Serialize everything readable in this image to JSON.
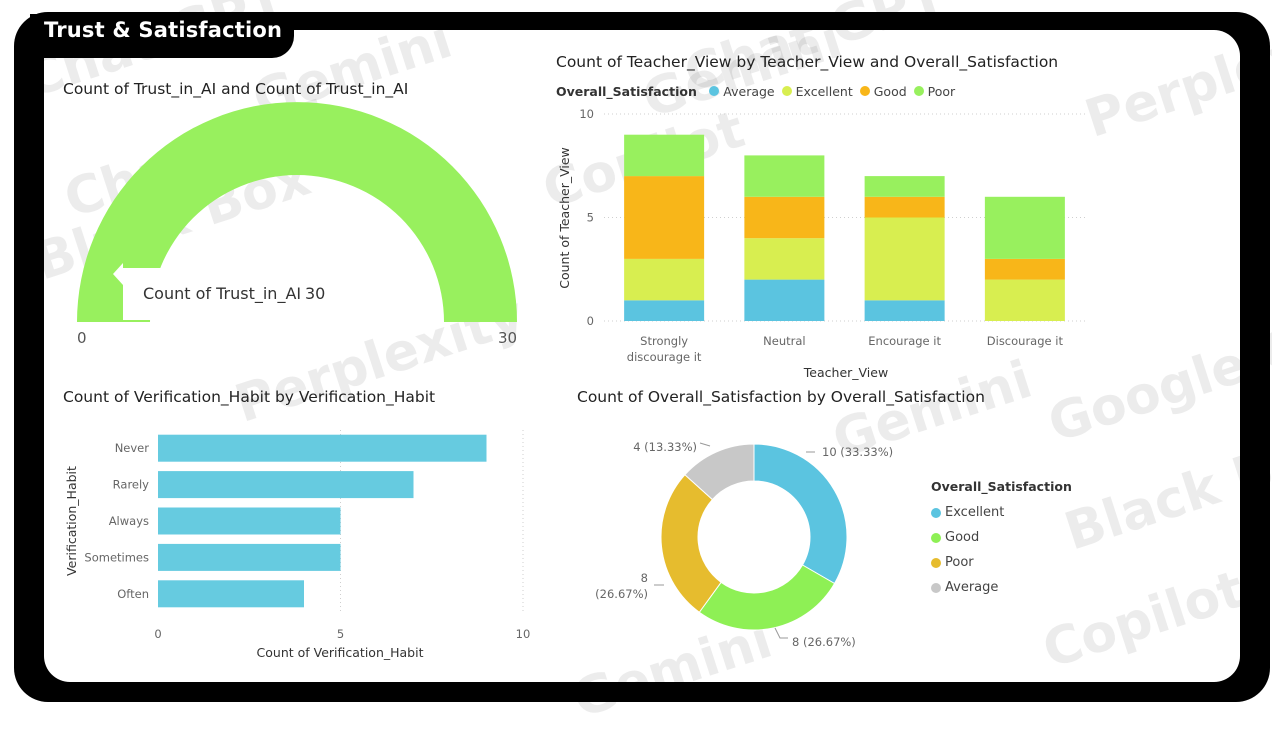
{
  "dashboard": {
    "title": "Trust & Satisfaction"
  },
  "colors": {
    "Average": "#5bc4e0",
    "Excellent": "#d8ee50",
    "Good": "#f8b619",
    "Poor": "#98f05e",
    "gauge_fill": "#98f05e",
    "bar_fill": "#66cbe0",
    "donut_Excellent": "#5bc4e0",
    "donut_Good": "#8ef055",
    "donut_Poor": "#e6bc2e",
    "donut_Average": "#c8c8c8"
  },
  "watermarks": [
    "Chat GPT",
    "Gemini",
    "Chat GPT",
    "Gemini",
    "Perplexity",
    "Chat GPT",
    "Black Box",
    "Copilot",
    "Google Gemini",
    "Black Box",
    "Copilot",
    "Gemini",
    "Perplexity",
    "Gemini"
  ],
  "chart_data": [
    {
      "type": "gauge",
      "title": "Count of Trust_in_AI and Count of Trust_in_AI",
      "value": 30,
      "min": 0,
      "max": 30,
      "min_label": "0",
      "max_label": "30",
      "tooltip_label": "Count of Trust_in_AI",
      "tooltip_value": "30"
    },
    {
      "type": "bar",
      "stacked": true,
      "title": "Count of Teacher_View by Teacher_View and Overall_Satisfaction",
      "xlabel": "Teacher_View",
      "ylabel": "Count of Teacher_View",
      "legend_title": "Overall_Satisfaction",
      "legend_position": "top-left",
      "categories": [
        [
          "Strongly",
          "discourage it"
        ],
        [
          "Neutral"
        ],
        [
          "Encourage it"
        ],
        [
          "Discourage it"
        ]
      ],
      "series": [
        {
          "name": "Average",
          "values": [
            1,
            2,
            1,
            0
          ]
        },
        {
          "name": "Excellent",
          "values": [
            2,
            2,
            4,
            2
          ]
        },
        {
          "name": "Good",
          "values": [
            4,
            2,
            1,
            1
          ]
        },
        {
          "name": "Poor",
          "values": [
            2,
            2,
            1,
            3
          ]
        }
      ],
      "ylim": [
        0,
        10
      ],
      "yticks": [
        "0",
        "5",
        "10"
      ],
      "grid": true
    },
    {
      "type": "bar",
      "orientation": "horizontal",
      "title": "Count of Verification_Habit by Verification_Habit",
      "xlabel": "Count of Verification_Habit",
      "ylabel": "Verification_Habit",
      "categories": [
        "Never",
        "Rarely",
        "Always",
        "Sometimes",
        "Often"
      ],
      "values": [
        9,
        7,
        5,
        5,
        4
      ],
      "xlim": [
        0,
        10
      ],
      "xticks": [
        "0",
        "5",
        "10"
      ],
      "grid": true
    },
    {
      "type": "pie",
      "donut": true,
      "title": "Count of Overall_Satisfaction by Overall_Satisfaction",
      "legend_title": "Overall_Satisfaction",
      "legend_position": "right",
      "slices": [
        {
          "name": "Excellent",
          "value": 10,
          "label": "10 (33.33%)"
        },
        {
          "name": "Good",
          "value": 8,
          "label": "8 (26.67%)"
        },
        {
          "name": "Poor",
          "value": 8,
          "label_lines": [
            "8",
            "(26.67%)"
          ]
        },
        {
          "name": "Average",
          "value": 4,
          "label": "4 (13.33%)"
        }
      ]
    }
  ]
}
